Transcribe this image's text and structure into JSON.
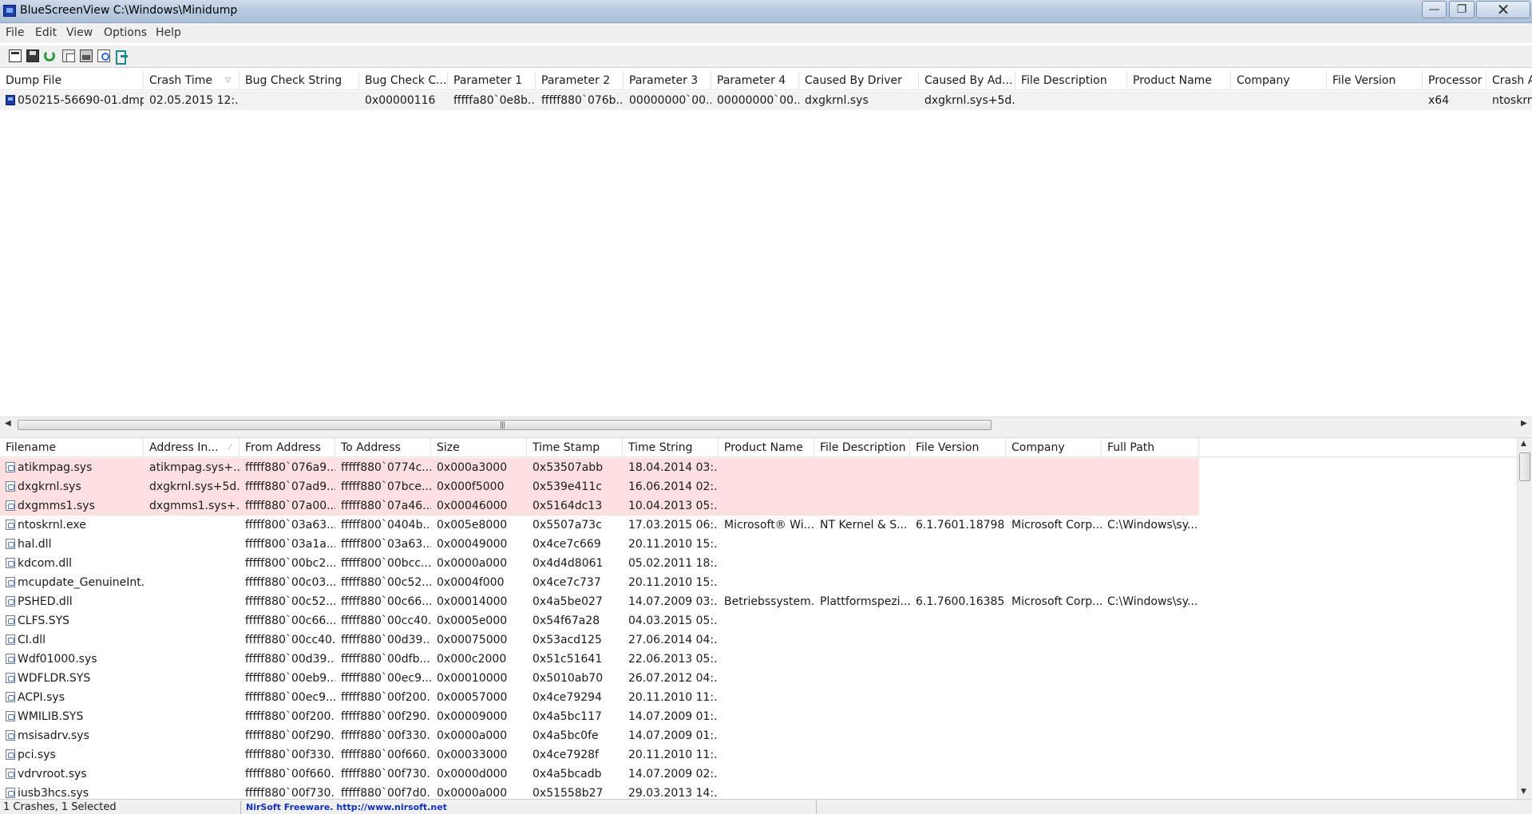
{
  "window": {
    "title": "BlueScreenView   C:\\Windows\\Minidump",
    "min_glyph": "—",
    "max_glyph": "❐",
    "close_glyph": "✕"
  },
  "menu": [
    "File",
    "Edit",
    "View",
    "Options",
    "Help"
  ],
  "toolbar": [
    "open-icon",
    "save-icon",
    "refresh-icon",
    "copy-icon",
    "properties-icon",
    "find-icon",
    "exit-icon"
  ],
  "top_table": {
    "columns": [
      "Dump File",
      "Crash Time",
      "Bug Check String",
      "Bug Check C...",
      "Parameter 1",
      "Parameter 2",
      "Parameter 3",
      "Parameter 4",
      "Caused By Driver",
      "Caused By Ad...",
      "File Description",
      "Product Name",
      "Company",
      "File Version",
      "Processor",
      "Crash Ad"
    ],
    "sorted_column": "Crash Time",
    "rows": [
      [
        "050215-56690-01.dmp",
        "02.05.2015 12:...",
        "",
        "0x00000116",
        "fffffa80`0e8b...",
        "fffff880`076b...",
        "00000000`00...",
        "00000000`00...",
        "dxgkrnl.sys",
        "dxgkrnl.sys+5d...",
        "",
        "",
        "",
        "",
        "x64",
        "ntoskrnl"
      ]
    ]
  },
  "bottom_table": {
    "columns": [
      "Filename",
      "Address In...",
      "From Address",
      "To Address",
      "Size",
      "Time Stamp",
      "Time String",
      "Product Name",
      "File Description",
      "File Version",
      "Company",
      "Full Path"
    ],
    "sorted_column": "Address In...",
    "rows": [
      {
        "highlight": true,
        "cells": [
          "atikmpag.sys",
          "atikmpag.sys+...",
          "fffff880`076a9...",
          "fffff880`0774c...",
          "0x000a3000",
          "0x53507abb",
          "18.04.2014 03:...",
          "",
          "",
          "",
          "",
          ""
        ]
      },
      {
        "highlight": true,
        "cells": [
          "dxgkrnl.sys",
          "dxgkrnl.sys+5d...",
          "fffff880`07ad9...",
          "fffff880`07bce...",
          "0x000f5000",
          "0x539e411c",
          "16.06.2014 02:...",
          "",
          "",
          "",
          "",
          ""
        ]
      },
      {
        "highlight": true,
        "cells": [
          "dxgmms1.sys",
          "dxgmms1.sys+...",
          "fffff880`07a00...",
          "fffff880`07a46...",
          "0x00046000",
          "0x5164dc13",
          "10.04.2013 05:...",
          "",
          "",
          "",
          "",
          ""
        ]
      },
      {
        "highlight": false,
        "cells": [
          "ntoskrnl.exe",
          "",
          "fffff800`03a63...",
          "fffff800`0404b...",
          "0x005e8000",
          "0x5507a73c",
          "17.03.2015 06:...",
          "Microsoft® Wi...",
          "NT Kernel & S...",
          "6.1.7601.18798...",
          "Microsoft Corp...",
          "C:\\Windows\\sy..."
        ]
      },
      {
        "highlight": false,
        "cells": [
          "hal.dll",
          "",
          "fffff800`03a1a...",
          "fffff800`03a63...",
          "0x00049000",
          "0x4ce7c669",
          "20.11.2010 15:...",
          "",
          "",
          "",
          "",
          ""
        ]
      },
      {
        "highlight": false,
        "cells": [
          "kdcom.dll",
          "",
          "fffff800`00bc2...",
          "fffff800`00bcc...",
          "0x0000a000",
          "0x4d4d8061",
          "05.02.2011 18:...",
          "",
          "",
          "",
          "",
          ""
        ]
      },
      {
        "highlight": false,
        "cells": [
          "mcupdate_GenuineInt...",
          "",
          "fffff880`00c03...",
          "fffff880`00c52...",
          "0x0004f000",
          "0x4ce7c737",
          "20.11.2010 15:...",
          "",
          "",
          "",
          "",
          ""
        ]
      },
      {
        "highlight": false,
        "cells": [
          "PSHED.dll",
          "",
          "fffff880`00c52...",
          "fffff880`00c66...",
          "0x00014000",
          "0x4a5be027",
          "14.07.2009 03:...",
          "Betriebssystem...",
          "Plattformspezi...",
          "6.1.7600.16385...",
          "Microsoft Corp...",
          "C:\\Windows\\sy..."
        ]
      },
      {
        "highlight": false,
        "cells": [
          "CLFS.SYS",
          "",
          "fffff880`00c66...",
          "fffff880`00cc40...",
          "0x0005e000",
          "0x54f67a28",
          "04.03.2015 05:...",
          "",
          "",
          "",
          "",
          ""
        ]
      },
      {
        "highlight": false,
        "cells": [
          "CI.dll",
          "",
          "fffff880`00cc40...",
          "fffff880`00d39...",
          "0x00075000",
          "0x53acd125",
          "27.06.2014 04:...",
          "",
          "",
          "",
          "",
          ""
        ]
      },
      {
        "highlight": false,
        "cells": [
          "Wdf01000.sys",
          "",
          "fffff880`00d39...",
          "fffff880`00dfb...",
          "0x000c2000",
          "0x51c51641",
          "22.06.2013 05:...",
          "",
          "",
          "",
          "",
          ""
        ]
      },
      {
        "highlight": false,
        "cells": [
          "WDFLDR.SYS",
          "",
          "fffff880`00eb9...",
          "fffff880`00ec9...",
          "0x00010000",
          "0x5010ab70",
          "26.07.2012 04:...",
          "",
          "",
          "",
          "",
          ""
        ]
      },
      {
        "highlight": false,
        "cells": [
          "ACPI.sys",
          "",
          "fffff880`00ec9...",
          "fffff880`00f200...",
          "0x00057000",
          "0x4ce79294",
          "20.11.2010 11:...",
          "",
          "",
          "",
          "",
          ""
        ]
      },
      {
        "highlight": false,
        "cells": [
          "WMILIB.SYS",
          "",
          "fffff880`00f200...",
          "fffff880`00f290...",
          "0x00009000",
          "0x4a5bc117",
          "14.07.2009 01:...",
          "",
          "",
          "",
          "",
          ""
        ]
      },
      {
        "highlight": false,
        "cells": [
          "msisadrv.sys",
          "",
          "fffff880`00f290...",
          "fffff880`00f330...",
          "0x0000a000",
          "0x4a5bc0fe",
          "14.07.2009 01:...",
          "",
          "",
          "",
          "",
          ""
        ]
      },
      {
        "highlight": false,
        "cells": [
          "pci.sys",
          "",
          "fffff880`00f330...",
          "fffff880`00f660...",
          "0x00033000",
          "0x4ce7928f",
          "20.11.2010 11:...",
          "",
          "",
          "",
          "",
          ""
        ]
      },
      {
        "highlight": false,
        "cells": [
          "vdrvroot.sys",
          "",
          "fffff880`00f660...",
          "fffff880`00f730...",
          "0x0000d000",
          "0x4a5bcadb",
          "14.07.2009 02:...",
          "",
          "",
          "",
          "",
          ""
        ]
      },
      {
        "highlight": false,
        "cells": [
          "iusb3hcs.sys",
          "",
          "fffff880`00f730...",
          "fffff880`00f7d0...",
          "0x0000a000",
          "0x51558b27",
          "29.03.2013 14:...",
          "",
          "",
          "",
          "",
          ""
        ]
      }
    ]
  },
  "status": {
    "left": "1 Crashes, 1 Selected",
    "link": "NirSoft Freeware.  http://www.nirsoft.net"
  },
  "colors": {
    "highlight_row": "#ffe0e0",
    "titlebar": "#b9cbe0",
    "link": "#1030c0"
  }
}
